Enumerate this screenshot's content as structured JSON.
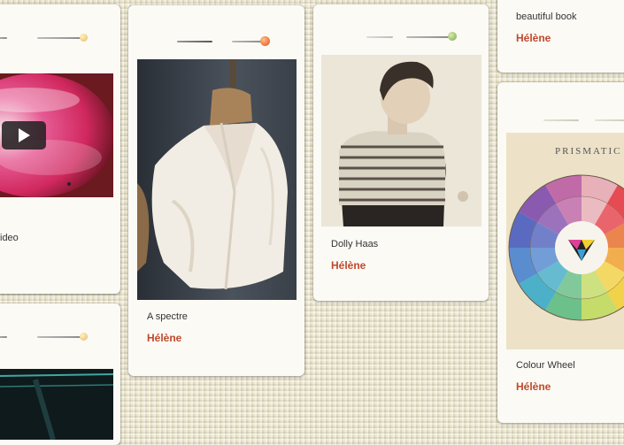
{
  "cards": [
    {
      "caption": "ideo",
      "author": ""
    },
    {
      "caption": "A spectre",
      "author": "Hélène"
    },
    {
      "caption": "Dolly Haas",
      "author": "Hélène"
    },
    {
      "caption": "beautiful book",
      "author": "Hélène"
    },
    {
      "caption": "Colour Wheel",
      "author": "Hélène"
    }
  ],
  "colour_wheel": {
    "title": "PRISMATIC"
  },
  "video": {
    "play_icon": "play-icon"
  },
  "colors": {
    "author": "#c0492b",
    "background": "#ece6cc",
    "card": "#fbfaf5"
  }
}
